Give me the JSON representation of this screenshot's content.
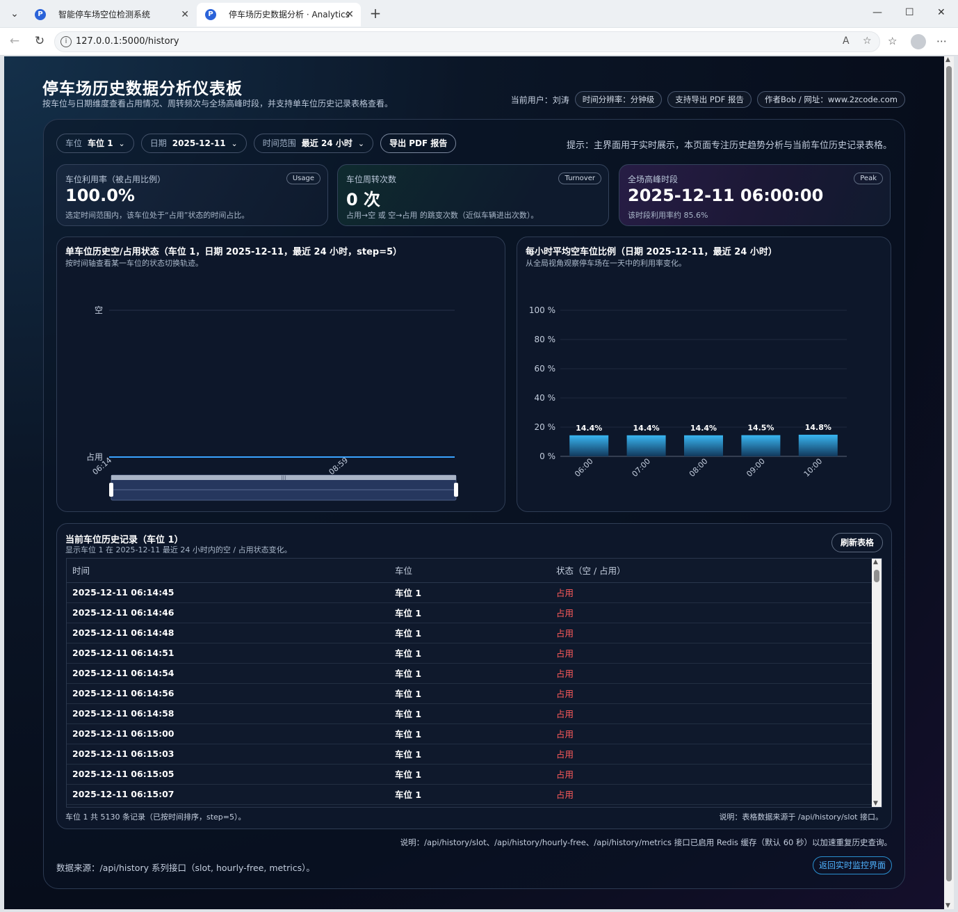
{
  "browser": {
    "tabs": [
      {
        "title": "智能停车场空位检测系统",
        "favicon": "P"
      },
      {
        "title": "停车场历史数据分析 · Analytics",
        "favicon": "P"
      }
    ],
    "url": "127.0.0.1:5000/history"
  },
  "header": {
    "title": "停车场历史数据分析仪表板",
    "subtitle": "按车位与日期维度查看占用情况、周转频次与全场高峰时段，并支持单车位历史记录表格查看。",
    "user": "当前用户：刘涛",
    "pills": [
      "时间分辨率：分钟级",
      "支持导出 PDF 报告",
      "作者Bob / 网址：www.2zcode.com"
    ]
  },
  "filters": {
    "slot_label": "车位",
    "slot_value": "车位 1",
    "date_label": "日期",
    "date_value": "2025-12-11",
    "range_label": "时间范围",
    "range_value": "最近 24 小时",
    "export_label": "导出 PDF 报告",
    "tip": "提示：主界面用于实时展示，本页面专注历史趋势分析与当前车位历史记录表格。"
  },
  "cards": [
    {
      "label": "车位利用率（被占用比例）",
      "badge": "Usage",
      "value": "100.0%",
      "note": "选定时间范围内，该车位处于“占用”状态的时间占比。"
    },
    {
      "label": "车位周转次数",
      "badge": "Turnover",
      "value": "0 次",
      "note": "占用→空 或 空→占用 的跳变次数（近似车辆进出次数）。"
    },
    {
      "label": "全场高峰时段",
      "badge": "Peak",
      "value": "2025-12-11 06:00:00",
      "note": "该时段利用率约 85.6%"
    }
  ],
  "chart_data": [
    {
      "type": "line",
      "title": "单车位历史空/占用状态（车位 1，日期 2025-12-11，最近 24 小时，step=5）",
      "subtitle": "按时间轴查看某一车位的状态切换轨迹。",
      "y_categories": [
        "占用",
        "空"
      ],
      "x_tick_labels": [
        "06:14",
        "08:59"
      ],
      "series": [
        {
          "values": [
            0,
            0
          ]
        }
      ],
      "color": "#3aa3ff",
      "has_zoom_slider": true
    },
    {
      "type": "bar",
      "title": "每小时平均空车位比例（日期 2025-12-11，最近 24 小时）",
      "subtitle": "从全局视角观察停车场在一天中的利用率变化。",
      "categories": [
        "06:00",
        "07:00",
        "08:00",
        "09:00",
        "10:00"
      ],
      "values": [
        14.4,
        14.4,
        14.4,
        14.5,
        14.8
      ],
      "data_labels": [
        "14.4%",
        "14.4%",
        "14.4%",
        "14.5%",
        "14.8%"
      ],
      "ylim": [
        0,
        100
      ],
      "y_ticks": [
        "0 %",
        "20 %",
        "40 %",
        "60 %",
        "80 %",
        "100 %"
      ],
      "color": "#2ea6e6"
    }
  ],
  "table": {
    "title": "当前车位历史记录（车位 1）",
    "subtitle": "显示车位 1 在 2025-12-11 最近 24 小时内的空 / 占用状态变化。",
    "refresh_label": "刷新表格",
    "columns": [
      "时间",
      "车位",
      "状态（空 / 占用）"
    ],
    "rows": [
      [
        "2025-12-11 06:14:45",
        "车位 1",
        "占用"
      ],
      [
        "2025-12-11 06:14:46",
        "车位 1",
        "占用"
      ],
      [
        "2025-12-11 06:14:48",
        "车位 1",
        "占用"
      ],
      [
        "2025-12-11 06:14:51",
        "车位 1",
        "占用"
      ],
      [
        "2025-12-11 06:14:54",
        "车位 1",
        "占用"
      ],
      [
        "2025-12-11 06:14:56",
        "车位 1",
        "占用"
      ],
      [
        "2025-12-11 06:14:58",
        "车位 1",
        "占用"
      ],
      [
        "2025-12-11 06:15:00",
        "车位 1",
        "占用"
      ],
      [
        "2025-12-11 06:15:03",
        "车位 1",
        "占用"
      ],
      [
        "2025-12-11 06:15:05",
        "车位 1",
        "占用"
      ],
      [
        "2025-12-11 06:15:07",
        "车位 1",
        "占用"
      ]
    ],
    "footer_left": "车位 1 共 5130 条记录（已按时间排序，step=5）。",
    "footer_right": "说明：表格数据来源于 /api/history/slot 接口。"
  },
  "footer": {
    "cache_note": "说明：/api/history/slot、/api/history/hourly-free、/api/history/metrics 接口已启用 Redis 缓存（默认 60 秒）以加速重复历史查询。",
    "source": "数据来源：/api/history 系列接口（slot, hourly-free, metrics）。",
    "back_label": "返回实时监控界面"
  }
}
